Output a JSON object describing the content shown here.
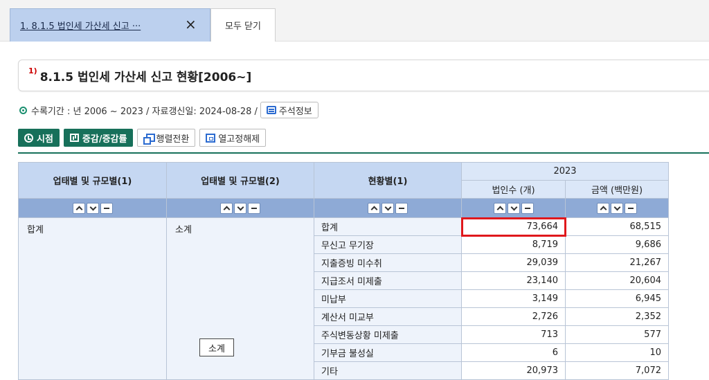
{
  "tabs": {
    "active_title": "1. 8.1.5 법인세 가산세 신고 ···",
    "close_icon": "×",
    "close_all_label": "모두 닫기"
  },
  "title": {
    "superscript": "1)",
    "text": "8.1.5 법인세 가산세 신고 현황[2006~]"
  },
  "info": {
    "period_text": "수록기간 : 년 2006 ~ 2023 / 자료갱신일: 2024-08-28 /",
    "note_button_label": "주석정보"
  },
  "toolbar": {
    "time_label": "시점",
    "change_label": "증감/증감률",
    "pivot_label": "행렬전환",
    "unfreeze_label": "열고정해제"
  },
  "table": {
    "col_headers": [
      "업태별 및 규모별(1)",
      "업태별 및 규모별(2)",
      "현황별(1)"
    ],
    "year_header": "2023",
    "sub_headers": [
      "법인수 (개)",
      "금액 (백만원)"
    ],
    "dim1_value": "합계",
    "dim2_value": "소계",
    "rows": [
      {
        "label": "합계",
        "count": "73,664",
        "amount": "68,515"
      },
      {
        "label": "무신고 무기장",
        "count": "8,719",
        "amount": "9,686"
      },
      {
        "label": "지출증빙 미수취",
        "count": "29,039",
        "amount": "21,267"
      },
      {
        "label": "지급조서 미제출",
        "count": "23,140",
        "amount": "20,604"
      },
      {
        "label": "미납부",
        "count": "3,149",
        "amount": "6,945"
      },
      {
        "label": "계산서 미교부",
        "count": "2,726",
        "amount": "2,352"
      },
      {
        "label": "주식변동상황 미제출",
        "count": "713",
        "amount": "577"
      },
      {
        "label": "기부금 불성실",
        "count": "6",
        "amount": "10"
      },
      {
        "label": "기타",
        "count": "20,973",
        "amount": "7,072"
      }
    ]
  },
  "tooltip": {
    "text": "소계"
  },
  "colors": {
    "accent_green": "#17705a",
    "header_blue": "#c5d7f2",
    "highlight_red": "#e0181c"
  }
}
